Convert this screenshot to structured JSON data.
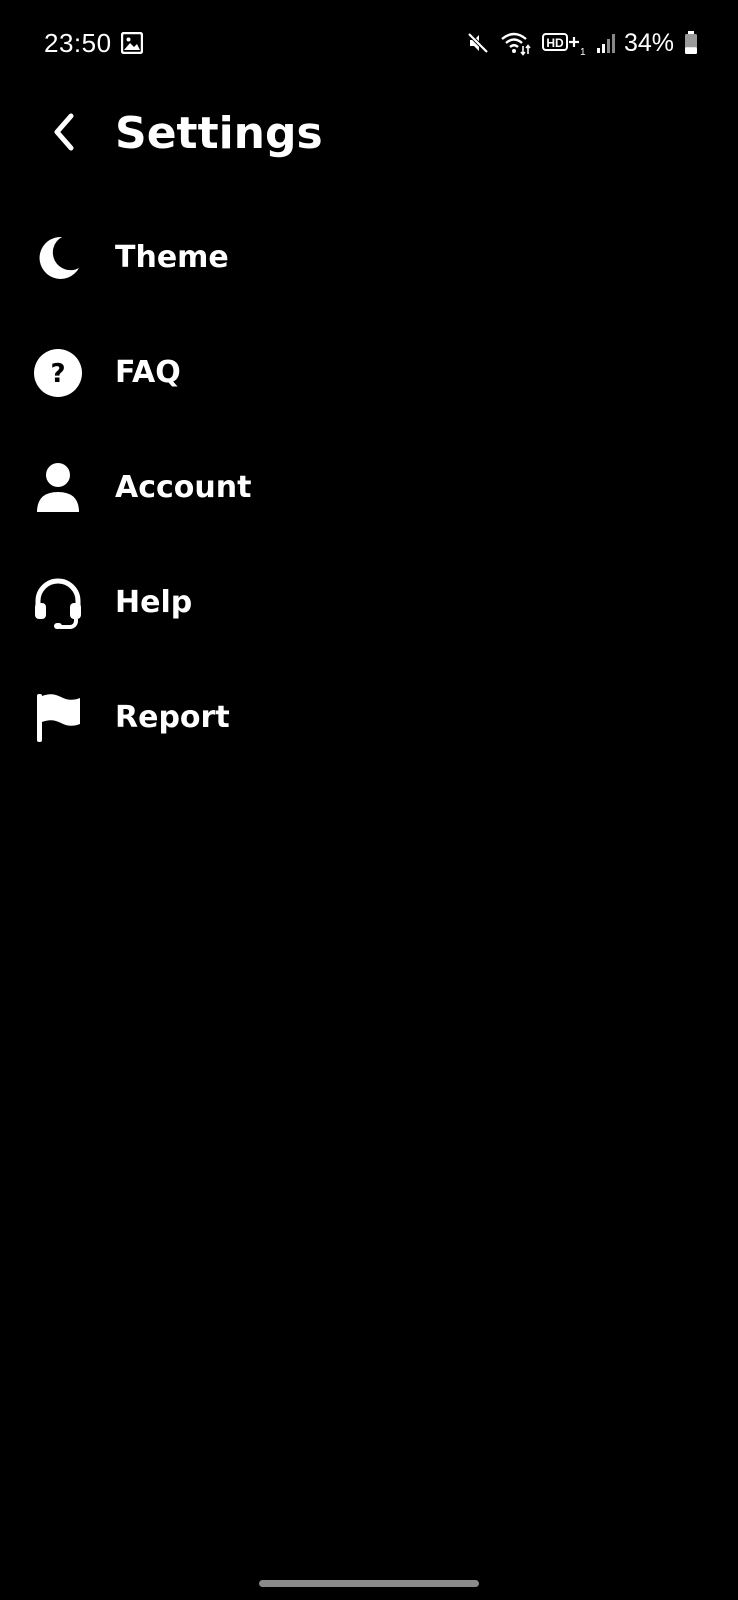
{
  "status_bar": {
    "time": "23:50",
    "battery_percent": "34%",
    "battery_level": 0.34,
    "icons": [
      "gallery-icon",
      "mute-icon",
      "wifi-icon",
      "volte-icon",
      "signal-icon",
      "battery-icon"
    ]
  },
  "header": {
    "title": "Settings",
    "back_icon": "chevron-left-icon"
  },
  "menu": {
    "items": [
      {
        "label": "Theme",
        "icon": "moon-icon"
      },
      {
        "label": "FAQ",
        "icon": "question-circle-icon"
      },
      {
        "label": "Account",
        "icon": "user-icon"
      },
      {
        "label": "Help",
        "icon": "headset-icon"
      },
      {
        "label": "Report",
        "icon": "flag-icon"
      }
    ]
  },
  "colors": {
    "background": "#000000",
    "foreground": "#ffffff",
    "home_indicator": "#8a8a8a"
  }
}
